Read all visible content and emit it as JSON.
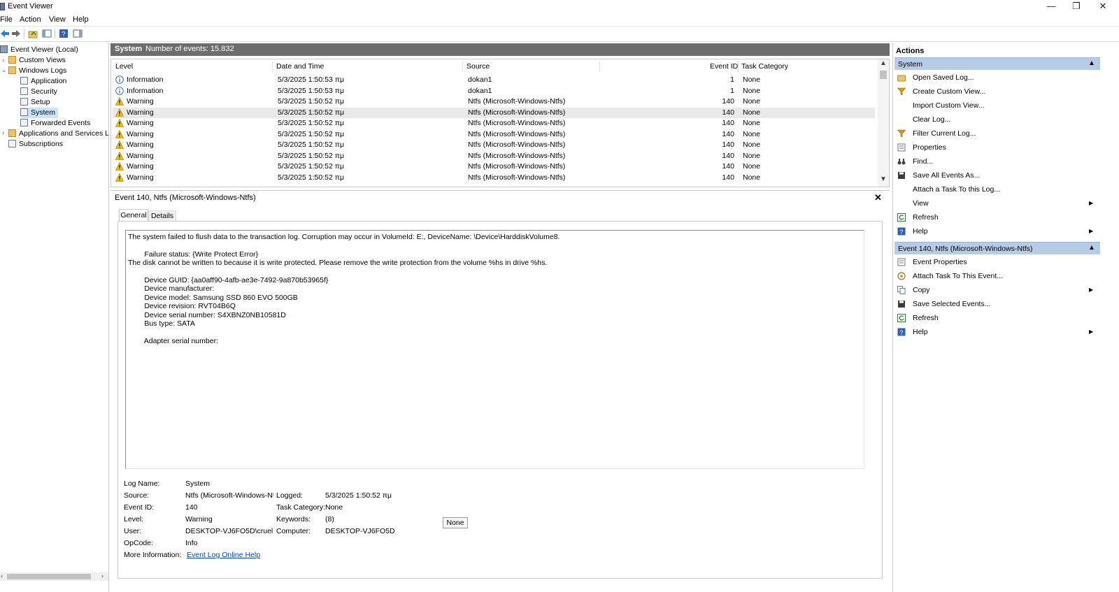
{
  "window": {
    "title": "Event Viewer",
    "min": "—",
    "max": "❐",
    "close": "✕"
  },
  "menu": [
    "File",
    "Action",
    "View",
    "Help"
  ],
  "tree": {
    "root": "Event Viewer (Local)",
    "custom_views": "Custom Views",
    "windows_logs": "Windows Logs",
    "application": "Application",
    "security": "Security",
    "setup": "Setup",
    "system": "System",
    "forwarded": "Forwarded Events",
    "apps_services": "Applications and Services Lo",
    "subscriptions": "Subscriptions"
  },
  "center": {
    "log_name": "System",
    "count_label": "Number of events: 15.832"
  },
  "events": {
    "columns": [
      "Level",
      "Date and Time",
      "Source",
      "Event ID",
      "Task Category"
    ],
    "rows": [
      {
        "level": "Information",
        "kind": "info",
        "date": "5/3/2025 1:50:53 πμ",
        "source": "dokan1",
        "id": "1",
        "cat": "None"
      },
      {
        "level": "Information",
        "kind": "info",
        "date": "5/3/2025 1:50:53 πμ",
        "source": "dokan1",
        "id": "1",
        "cat": "None"
      },
      {
        "level": "Warning",
        "kind": "warn",
        "date": "5/3/2025 1:50:52 πμ",
        "source": "Ntfs (Microsoft-Windows-Ntfs)",
        "id": "140",
        "cat": "None"
      },
      {
        "level": "Warning",
        "kind": "warn",
        "date": "5/3/2025 1:50:52 πμ",
        "source": "Ntfs (Microsoft-Windows-Ntfs)",
        "id": "140",
        "cat": "None"
      },
      {
        "level": "Warning",
        "kind": "warn",
        "date": "5/3/2025 1:50:52 πμ",
        "source": "Ntfs (Microsoft-Windows-Ntfs)",
        "id": "140",
        "cat": "None"
      },
      {
        "level": "Warning",
        "kind": "warn",
        "date": "5/3/2025 1:50:52 πμ",
        "source": "Ntfs (Microsoft-Windows-Ntfs)",
        "id": "140",
        "cat": "None"
      },
      {
        "level": "Warning",
        "kind": "warn",
        "date": "5/3/2025 1:50:52 πμ",
        "source": "Ntfs (Microsoft-Windows-Ntfs)",
        "id": "140",
        "cat": "None"
      },
      {
        "level": "Warning",
        "kind": "warn",
        "date": "5/3/2025 1:50:52 πμ",
        "source": "Ntfs (Microsoft-Windows-Ntfs)",
        "id": "140",
        "cat": "None"
      },
      {
        "level": "Warning",
        "kind": "warn",
        "date": "5/3/2025 1:50:52 πμ",
        "source": "Ntfs (Microsoft-Windows-Ntfs)",
        "id": "140",
        "cat": "None"
      },
      {
        "level": "Warning",
        "kind": "warn",
        "date": "5/3/2025 1:50:52 πμ",
        "source": "Ntfs (Microsoft-Windows-Ntfs)",
        "id": "140",
        "cat": "None"
      }
    ]
  },
  "detail": {
    "title": "Event 140, Ntfs (Microsoft-Windows-Ntfs)",
    "tabs": [
      "General",
      "Details"
    ],
    "description": [
      "The system failed to flush data to the transaction log. Corruption may occur in VolumeId: E:, DeviceName: \\Device\\HarddiskVolume8.",
      "",
      "        Failure status: {Write Protect Error}",
      "The disk cannot be written to because it is write protected. Please remove the write protection from the volume %hs in drive %hs.",
      "",
      "        Device GUID: {aa0aff90-4afb-ae3e-7492-9a870b53965f}",
      "        Device manufacturer:",
      "        Device model: Samsung SSD 860 EVO 500GB",
      "        Device revision: RVT04B6Q",
      "        Device serial number: S4XBNZ0NB10581D",
      "        Bus type: SATA",
      "",
      "        Adapter serial number:"
    ],
    "meta": {
      "log_name_label": "Log Name:",
      "log_name": "System",
      "source_label": "Source:",
      "source": "Ntfs (Microsoft-Windows-Ntfs)",
      "logged_label": "Logged:",
      "logged": "5/3/2025 1:50:52 πμ",
      "event_id_label": "Event ID:",
      "event_id": "140",
      "task_cat_label": "Task Category:",
      "task_cat": "None",
      "level_label": "Level:",
      "level": "Warning",
      "keywords_label": "Keywords:",
      "keywords": "(8)",
      "user_label": "User:",
      "user": "DESKTOP-VJ6FO5D\\cruel",
      "computer_label": "Computer:",
      "computer": "DESKTOP-VJ6FO5D",
      "opcode_label": "OpCode:",
      "opcode": "Info",
      "more_info_label": "More Information:",
      "more_info_link": "Event Log Online Help",
      "none_box": "None"
    }
  },
  "actions": {
    "title": "Actions",
    "section1": "System",
    "section1_items": [
      {
        "label": "Open Saved Log...",
        "icon": "folder-open-icon"
      },
      {
        "label": "Create Custom View...",
        "icon": "filter-icon"
      },
      {
        "label": "Import Custom View...",
        "icon": ""
      },
      {
        "label": "Clear Log...",
        "icon": ""
      },
      {
        "label": "Filter Current Log...",
        "icon": "filter-icon"
      },
      {
        "label": "Properties",
        "icon": "properties-icon"
      },
      {
        "label": "Find...",
        "icon": "binoculars-icon"
      },
      {
        "label": "Save All Events As...",
        "icon": "save-icon"
      },
      {
        "label": "Attach a Task To this Log...",
        "icon": ""
      },
      {
        "label": "View",
        "icon": "",
        "submenu": true
      },
      {
        "label": "Refresh",
        "icon": "refresh-icon"
      },
      {
        "label": "Help",
        "icon": "help-icon",
        "submenu": true
      }
    ],
    "section2": "Event 140, Ntfs (Microsoft-Windows-Ntfs)",
    "section2_items": [
      {
        "label": "Event Properties",
        "icon": "properties-icon"
      },
      {
        "label": "Attach Task To This Event...",
        "icon": "task-icon"
      },
      {
        "label": "Copy",
        "icon": "copy-icon",
        "submenu": true
      },
      {
        "label": "Save Selected Events...",
        "icon": "save-icon"
      },
      {
        "label": "Refresh",
        "icon": "refresh-icon"
      },
      {
        "label": "Help",
        "icon": "help-icon",
        "submenu": true
      }
    ]
  },
  "colors": {
    "section_header": "#b6cbe4",
    "log_header": "#6d6d6d",
    "selection": "#cce4f7",
    "link": "#0645ad"
  }
}
